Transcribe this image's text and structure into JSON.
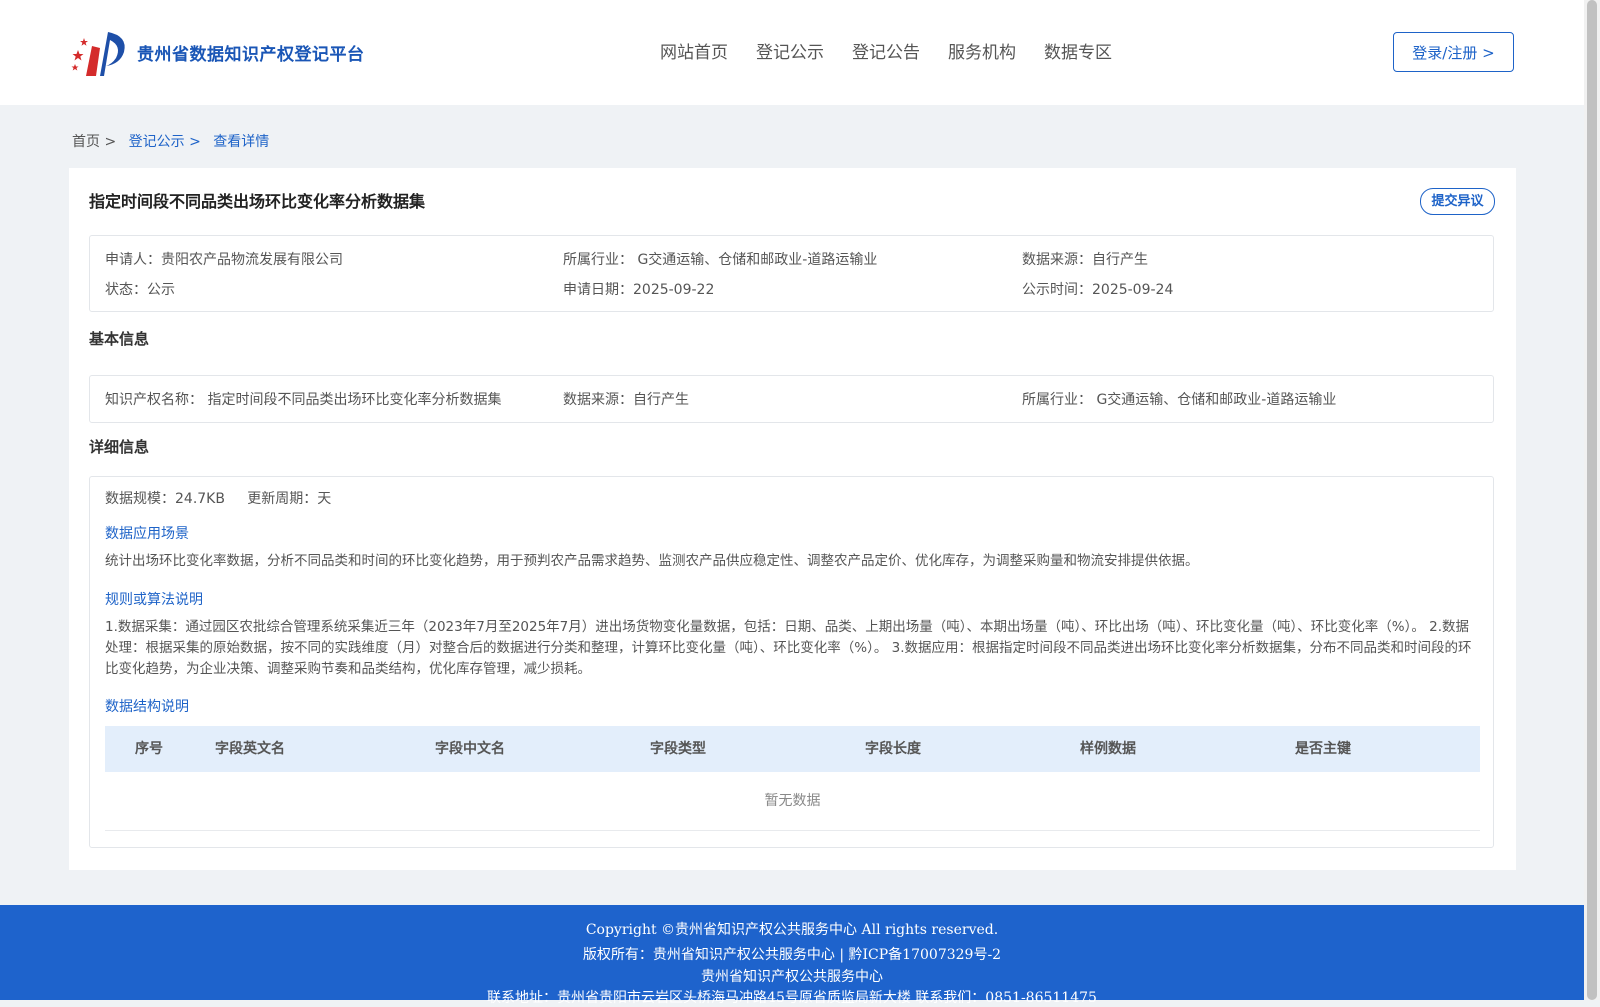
{
  "header": {
    "site_name": "贵州省数据知识产权登记平台",
    "nav": [
      "网站首页",
      "登记公示",
      "登记公告",
      "服务机构",
      "数据专区"
    ],
    "login_label": "登录/注册 >"
  },
  "breadcrumb": {
    "home": "首页 >",
    "list": "登记公示 >",
    "current": "查看详情"
  },
  "detail": {
    "title": "指定时间段不同品类出场环比变化率分析数据集",
    "objection_label": "提交异议",
    "summary": {
      "applicant_label": "申请人：",
      "applicant": "贵阳农产品物流发展有限公司",
      "industry_label": "所属行业：",
      "industry": "G交通运输、仓储和邮政业-道路运输业",
      "source_label": "数据来源：",
      "source": "自行产生",
      "status_label": "状态：",
      "status": "公示",
      "apply_date_label": "申请日期：",
      "apply_date": "2025-09-22",
      "publish_date_label": "公示时间：",
      "publish_date": "2025-09-24"
    },
    "basic": {
      "section_title": "基本信息",
      "ip_name_label": "知识产权名称：",
      "ip_name": "指定时间段不同品类出场环比变化率分析数据集",
      "source_label": "数据来源：",
      "source": "自行产生",
      "industry_label": "所属行业：",
      "industry": "G交通运输、仓储和邮政业-道路运输业"
    },
    "details": {
      "section_title": "详细信息",
      "scale_label": "数据规模：",
      "scale": "24.7KB",
      "cycle_label": "更新周期：",
      "cycle": "天",
      "scenario_title": "数据应用场景",
      "scenario_text": "统计出场环比变化率数据，分析不同品类和时间的环比变化趋势，用于预判农产品需求趋势、监测农产品供应稳定性、调整农产品定价、优化库存，为调整采购量和物流安排提供依据。",
      "rules_title": "规则或算法说明",
      "rules_text": "1.数据采集：通过园区农批综合管理系统采集近三年（2023年7月至2025年7月）进出场货物变化量数据，包括：日期、品类、上期出场量（吨）、本期出场量（吨）、环比出场（吨）、环比变化量（吨）、环比变化率（%）。 2.数据处理：根据采集的原始数据，按不同的实践维度（月）对整合后的数据进行分类和整理，计算环比变化量（吨）、环比变化率（%）。 3.数据应用：根据指定时间段不同品类进出场环比变化率分析数据集，分布不同品类和时间段的环比变化趋势，为企业决策、调整采购节奏和品类结构，优化库存管理，减少损耗。",
      "structure_title": "数据结构说明",
      "table_headers": [
        "序号",
        "字段英文名",
        "字段中文名",
        "字段类型",
        "字段长度",
        "样例数据",
        "是否主键"
      ],
      "empty_text": "暂无数据"
    }
  },
  "footer": {
    "copyright": "Copyright ©贵州省知识产权公共服务中心 All rights reserved.",
    "owner": "版权所有：贵州省知识产权公共服务中心 | 黔ICP备17007329号-2",
    "org": "贵州省知识产权公共服务中心",
    "contact": "联系地址：贵州省贵阳市云岩区头桥海马冲路45号原省质监局新大楼 联系我们：0851-86511475"
  },
  "colors": {
    "brand": "#1e63c8",
    "footer_bg": "#1e63cc",
    "table_head_bg": "#e3eefb",
    "page_bg": "#eff2f5"
  }
}
